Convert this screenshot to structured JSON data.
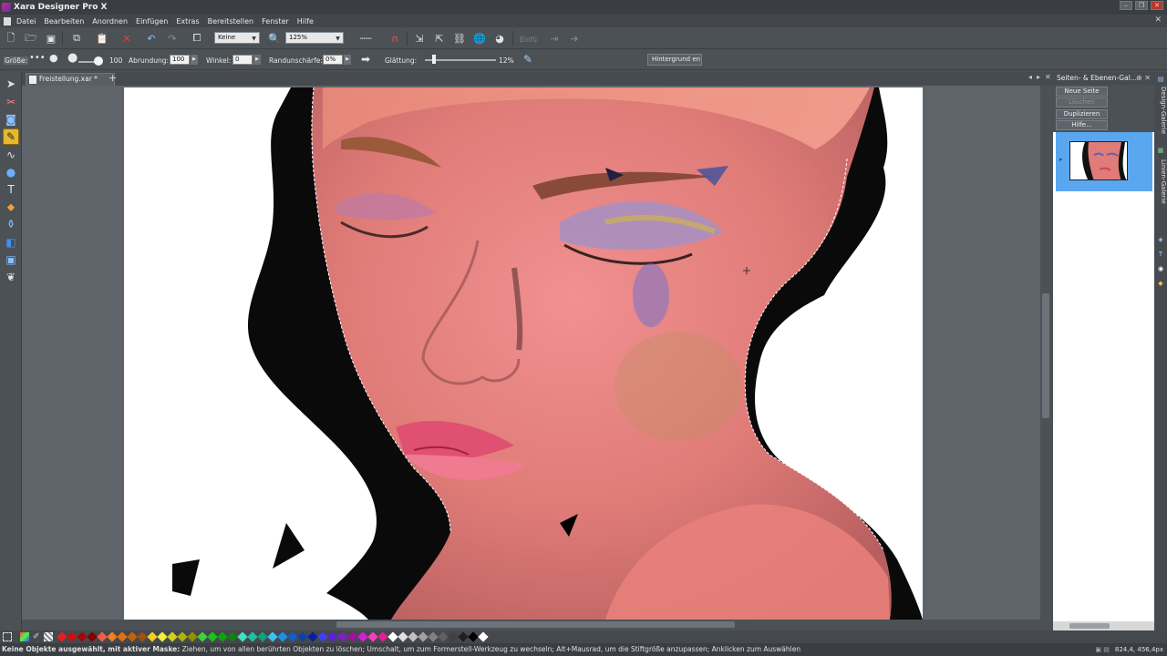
{
  "window": {
    "title": "Xara Designer Pro X"
  },
  "menu": [
    "Datei",
    "Bearbeiten",
    "Anordnen",
    "Einfügen",
    "Extras",
    "Bereitstellen",
    "Fenster",
    "Hilfe"
  ],
  "toolbar1": {
    "fill_combo": "Keine",
    "zoom_combo": "125%",
    "paste_label": "Einfü"
  },
  "toolbar2": {
    "size_label": "Größe:",
    "size_value": "100",
    "rounding_label": "Abrundung:",
    "rounding_value": "100",
    "angle_label": "Winkel:",
    "angle_value": "0",
    "edge_label": "Randunschärfe:",
    "edge_value": "0%",
    "smoothing_label": "Glättung:",
    "smoothing_value": "12%",
    "background_button": "Hintergrund en"
  },
  "document_tab": {
    "label": "Freistellung.xar *"
  },
  "panel": {
    "title": "Seiten- & Ebenen-Gal...",
    "buttons": {
      "new_page": "Neue Seite",
      "delete": "Löschen",
      "duplicate": "Duplizieren",
      "help": "Hilfe..."
    }
  },
  "sidetabs": {
    "design": "Design-Galerie",
    "lines": "Linien-Galerie"
  },
  "status": {
    "bold": "Keine Objekte ausgewählt, mit aktiver Maske:",
    "text": " Ziehen, um von allen berührten Objekten zu löschen; Umschalt, um zum Formerstell-Werkzeug zu wechseln; Alt+Mausrad, um die Stiftgröße anzupassen; Anklicken zum Auswählen",
    "coords": "824,4, 456,4px"
  },
  "colors": {
    "accent": "#e6b830",
    "selection": "#5aa7f0",
    "palette": [
      "#e02020",
      "#c81010",
      "#a00808",
      "#800000",
      "#f06040",
      "#f08020",
      "#e07010",
      "#c06010",
      "#a05010",
      "#f0d020",
      "#f0f040",
      "#d0d020",
      "#b0b010",
      "#909000",
      "#40d040",
      "#20c020",
      "#10a010",
      "#108010",
      "#40e0c0",
      "#20c0a0",
      "#10a080",
      "#40c0f0",
      "#2090e0",
      "#1060c0",
      "#1040a0",
      "#0820a0",
      "#4040f0",
      "#6020d0",
      "#8020c0",
      "#a010a0",
      "#d020d0",
      "#f040c0",
      "#e02090",
      "#ffffff",
      "#e0e0e0",
      "#c0c0c0",
      "#a0a0a0",
      "#808080",
      "#606060",
      "#404040",
      "#202020",
      "#000000",
      "#ffffff"
    ]
  }
}
